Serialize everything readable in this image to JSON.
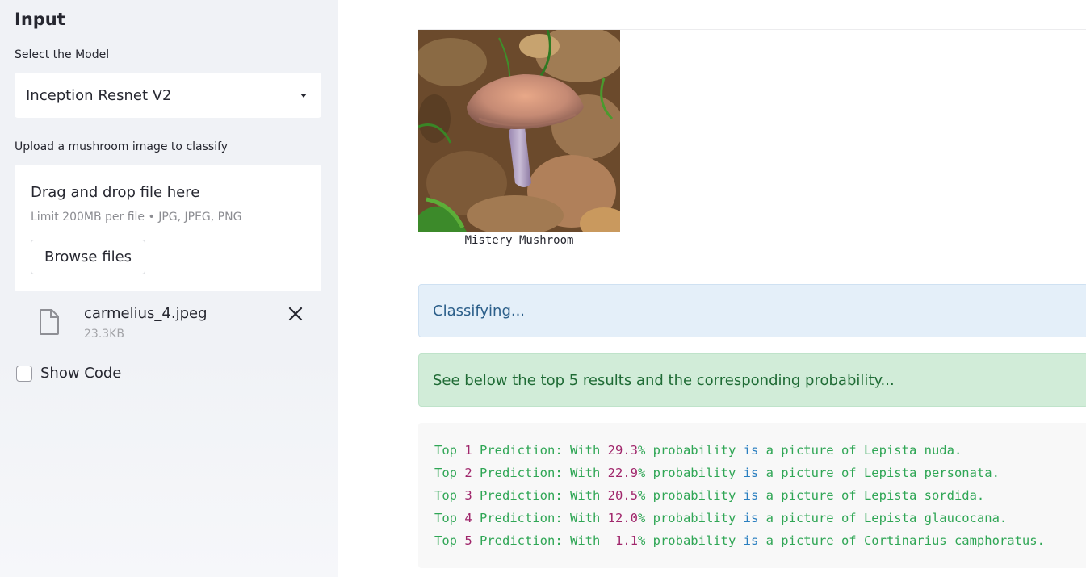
{
  "sidebar": {
    "title": "Input",
    "model_label": "Select the Model",
    "model_value": "Inception Resnet V2",
    "upload_label": "Upload a mushroom image to classify",
    "dropzone": {
      "title": "Drag and drop file here",
      "limit": "Limit 200MB per file • JPG, JPEG, PNG",
      "browse_label": "Browse files"
    },
    "file": {
      "name": "carmelius_4.jpeg",
      "size": "23.3KB"
    },
    "show_code_label": "Show Code"
  },
  "main": {
    "image_caption": "Mistery Mushroom",
    "info_message": "Classifying...",
    "success_message": "See below the top 5 results and the corresponding probability...",
    "predictions": [
      {
        "rank": "1",
        "prob": "29.3",
        "species": "Lepista nuda"
      },
      {
        "rank": "2",
        "prob": "22.9",
        "species": "Lepista personata"
      },
      {
        "rank": "3",
        "prob": "20.5",
        "species": "Lepista sordida"
      },
      {
        "rank": "4",
        "prob": "12.0",
        "species": "Lepista glaucocana"
      },
      {
        "rank": "5",
        "prob": " 1.1",
        "species": "Cortinarius camphoratus"
      }
    ],
    "prediction_text": {
      "top": "Top",
      "prediction_with": "Prediction: With",
      "probability": "probability",
      "is": "is",
      "a_picture_of": "a picture of",
      "percent": "%",
      "period": "."
    }
  },
  "colors": {
    "sidebar_bg": "#f0f2f6",
    "info_bg": "#e4eff9",
    "success_bg": "#d1ecd8",
    "code_green": "#2fa655",
    "code_number": "#a0266b",
    "code_keyword": "#2a7fc0"
  },
  "icons": {
    "dropdown": "chevron-down-icon",
    "file": "file-icon",
    "remove": "close-icon"
  }
}
